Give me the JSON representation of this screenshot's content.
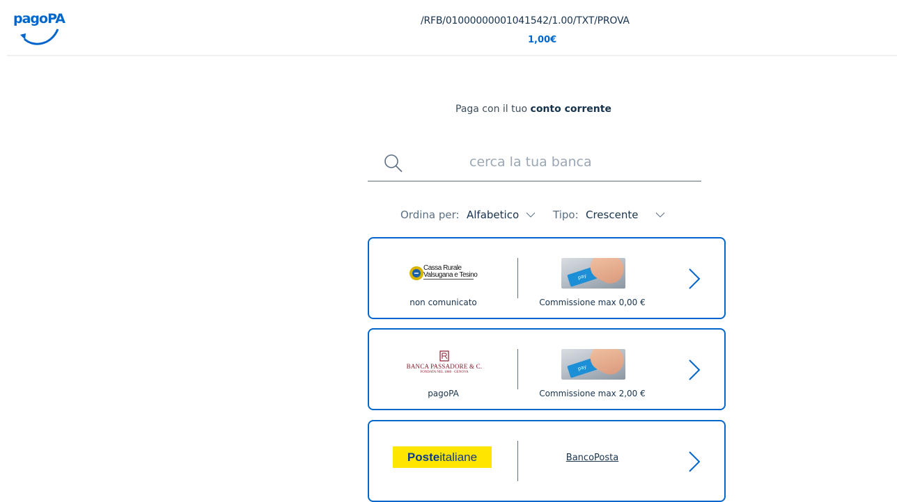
{
  "header": {
    "logo_text": "pagoPA",
    "payment_reference": "/RFB/01000000001041542/1.00/TXT/PROVA",
    "amount": "1,00€"
  },
  "main": {
    "subtitle_prefix": "Paga con il tuo",
    "subtitle_bold": "conto corrente",
    "search": {
      "placeholder": "cerca la tua banca"
    },
    "sort": {
      "order_label": "Ordina per:",
      "order_value": "Alfabetico",
      "type_label": "Tipo:",
      "type_value": "Crescente"
    }
  },
  "banks": [
    {
      "logo_text_line1": "Cassa Rurale",
      "logo_text_line2": "Valsugana e Tesino",
      "left_caption": "non comunicato",
      "right_caption": "Commissione max 0,00 €"
    },
    {
      "logo_text": "BANCA PASSADORE & C.",
      "logo_subtext": "FONDATA NEL 1888 · GENOVA",
      "left_caption": "pagoPA",
      "right_caption": "Commissione max 2,00 €"
    },
    {
      "logo_bold": "Poste",
      "logo_rest": "italiane",
      "right_label": "BancoPosta"
    }
  ],
  "colors": {
    "brand": "#0066cc",
    "text": "#17324d",
    "muted": "#5c6f82",
    "poste_yellow": "#ffe600"
  }
}
